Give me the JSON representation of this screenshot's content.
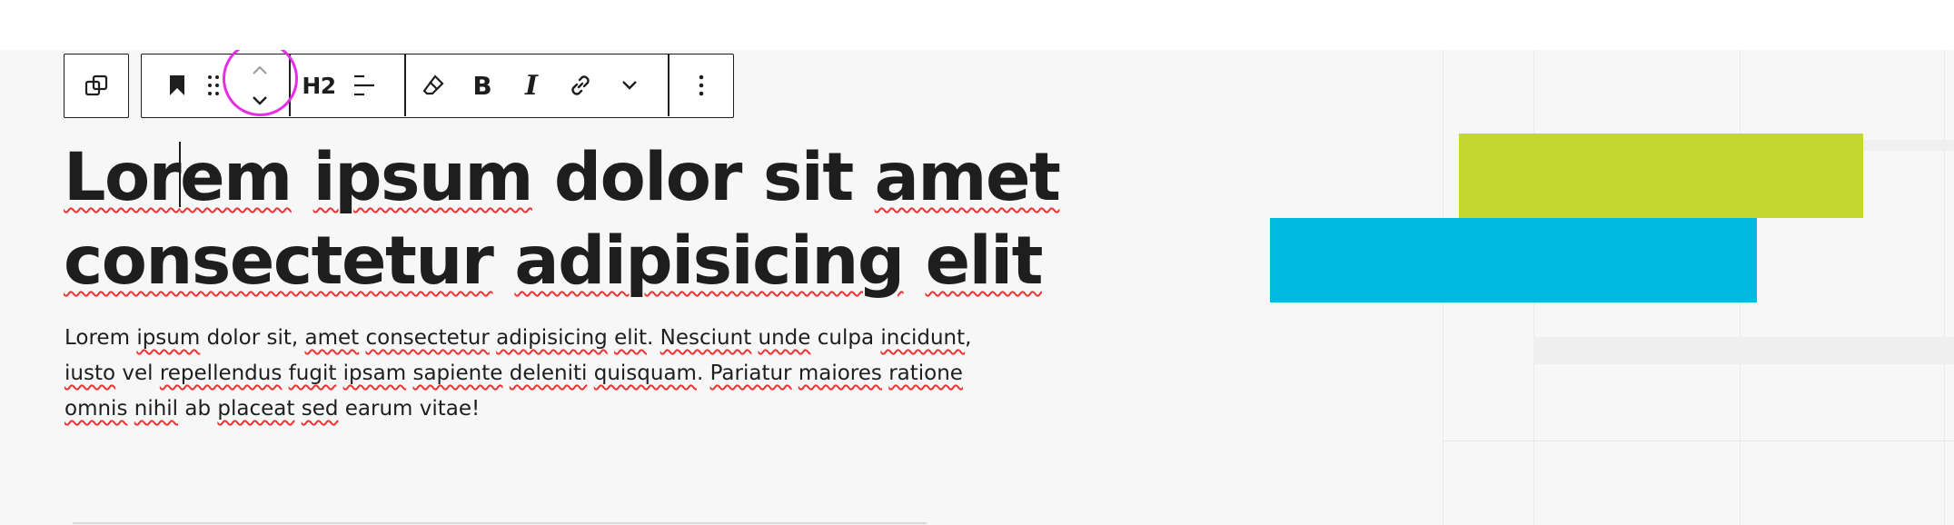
{
  "toolbar": {
    "transform_button": {
      "icon": "block-transform-icon",
      "label": "Transform"
    },
    "bookmark_button": {
      "icon": "bookmark-icon"
    },
    "drag_handle": {
      "icon": "drag-handle-icon"
    },
    "move_up_button": {
      "icon": "chevron-up-icon"
    },
    "move_down_button": {
      "icon": "chevron-down-icon"
    },
    "heading_level": "H2",
    "align_button": {
      "icon": "align-left-icon"
    },
    "highlight_button": {
      "icon": "eraser-icon"
    },
    "bold": "B",
    "italic": "I",
    "link_button": {
      "icon": "link-icon"
    },
    "more_formats_button": {
      "icon": "chevron-down-icon"
    },
    "options_button": {
      "icon": "kebab-menu-icon"
    }
  },
  "heading": {
    "line1_part1": "Lor",
    "line1_part2": "em",
    "line1_rest1": " ",
    "w_ipsum": "ipsum",
    "w_dolor_sit": " dolor sit ",
    "w_amet": "amet",
    "w_consectetur": "consectetur",
    "w_adipisicing": "adipisicing",
    "w_elit": "elit"
  },
  "paragraph": {
    "t1": "Lorem ",
    "ipsum": "ipsum",
    "t2": " dolor sit, ",
    "amet": "amet",
    "t3": " ",
    "consectetur": "consectetur",
    "t4": " ",
    "adipisicing": "adipisicing",
    "t5": " ",
    "elit": "elit",
    "t6": ". ",
    "nesciunt": "Nesciunt",
    "t7": " ",
    "unde": "unde",
    "t8": " culpa ",
    "incidunt": "incidunt",
    "t9": ",",
    "iusto": "iusto",
    "t10": " vel ",
    "repellendus": "repellendus",
    "t11": " ",
    "fugit": "fugit",
    "t12": " ",
    "ipsam": "ipsam",
    "t13": " ",
    "sapiente": "sapiente",
    "t14": " ",
    "deleniti": "deleniti",
    "t15": " ",
    "quisquam": "quisquam",
    "t16": ". ",
    "pariatur": "Pariatur",
    "t17": " ",
    "maiores": "maiores",
    "t18": " ",
    "ratione": "ratione",
    "omnis": "omnis",
    "t19": " ",
    "nihil": "nihil",
    "t20": " ab ",
    "placeat": "placeat",
    "t21": " ",
    "sed": "sed",
    "t22": " earum vitae!"
  },
  "colors": {
    "lime_block": "#c2d82e",
    "cyan_block": "#00b9e0",
    "highlight_ring": "#e62ee6"
  }
}
